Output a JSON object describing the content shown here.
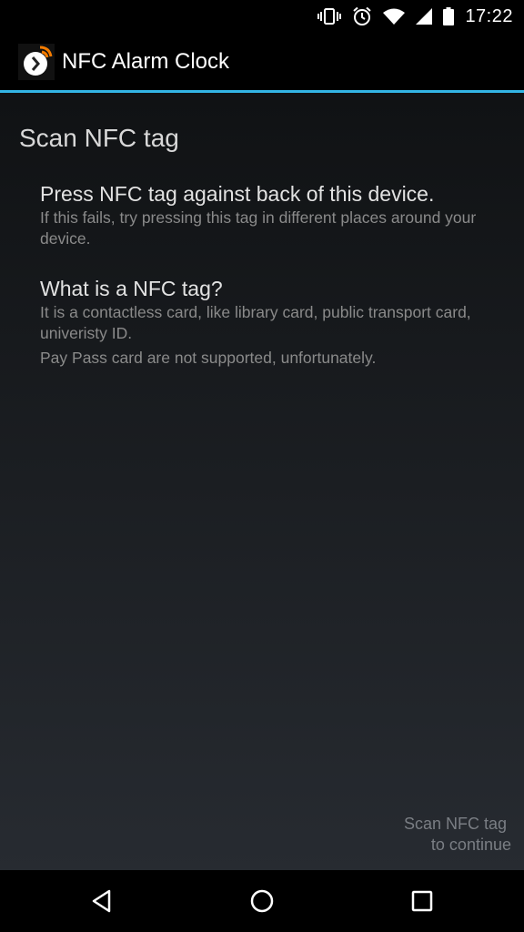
{
  "status_bar": {
    "time": "17:22",
    "icons": [
      "vibrate-icon",
      "alarm-icon",
      "wifi-icon",
      "signal-icon",
      "battery-icon"
    ]
  },
  "action_bar": {
    "title": "NFC Alarm Clock",
    "icon": "alarm-clock-app-icon",
    "accent_color": "#33b5e5"
  },
  "main": {
    "section_title": "Scan NFC tag",
    "items": [
      {
        "title": "Press NFC tag against back of this device.",
        "lines": [
          "If this fails, try pressing this tag in different places around your device."
        ]
      },
      {
        "title": "What is a NFC tag?",
        "lines": [
          "It is a contactless card, like library card, public transport card, univeristy ID.",
          "Pay Pass card are not supported, unfortunately."
        ]
      }
    ],
    "hint_line1": "Scan NFC tag",
    "hint_line2": "to continue"
  },
  "nav_bar": {
    "icons": [
      "back-icon",
      "home-icon",
      "recents-icon"
    ]
  }
}
